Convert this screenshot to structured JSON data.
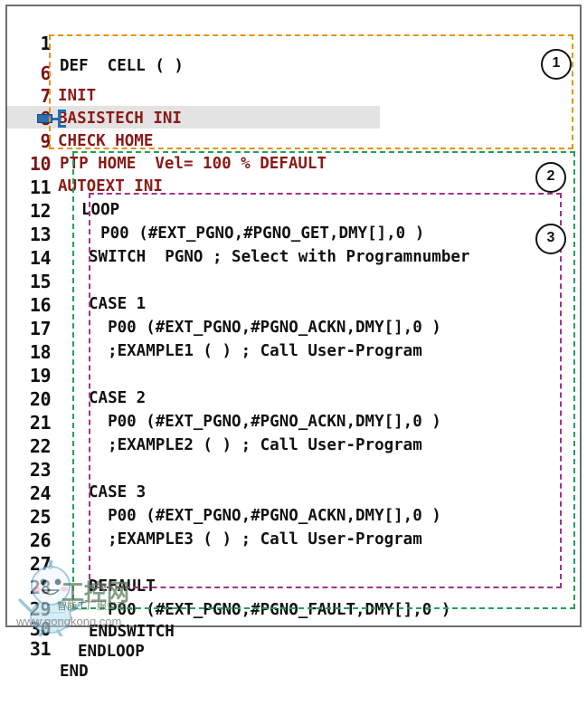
{
  "editor": {
    "name": "krl-program-listing",
    "lines": [
      {
        "num": "1",
        "text": "DEF  CELL ( )",
        "color": "black",
        "indent": 0
      },
      {
        "num": "6",
        "text": "INIT",
        "color": "red",
        "indent": 0
      },
      {
        "num": "7",
        "text": "BASISTECH INI",
        "color": "red",
        "indent": 0
      },
      {
        "num": "8",
        "text": "CHECK HOME",
        "color": "red",
        "indent": 0
      },
      {
        "num": "9",
        "text": "PTP HOME  Vel= 100 % DEFAULT",
        "color": "red",
        "indent": 0
      },
      {
        "num": "10",
        "text": "AUTOEXT INI",
        "color": "red",
        "indent": 0
      },
      {
        "num": "11",
        "text": "LOOP",
        "color": "black",
        "indent": 1
      },
      {
        "num": "12",
        "text": "  P00 (#EXT_PGNO,#PGNO_GET,DMY[],0 )",
        "color": "black",
        "indent": 1
      },
      {
        "num": "13",
        "text": "SWITCH  PGNO ; Select with Programnumber",
        "color": "black",
        "indent": 2
      },
      {
        "num": "14",
        "text": "",
        "color": "black",
        "indent": 2
      },
      {
        "num": "15",
        "text": "CASE 1",
        "color": "black",
        "indent": 2
      },
      {
        "num": "16",
        "text": "  P00 (#EXT_PGNO,#PGNO_ACKN,DMY[],0 )",
        "color": "black",
        "indent": 2
      },
      {
        "num": "17",
        "text": "  ;EXAMPLE1 ( ) ; Call User-Program",
        "color": "black",
        "indent": 2
      },
      {
        "num": "18",
        "text": "",
        "color": "black",
        "indent": 2
      },
      {
        "num": "19",
        "text": "CASE 2",
        "color": "black",
        "indent": 2
      },
      {
        "num": "20",
        "text": "  P00 (#EXT_PGNO,#PGNO_ACKN,DMY[],0 )",
        "color": "black",
        "indent": 2
      },
      {
        "num": "21",
        "text": "  ;EXAMPLE2 ( ) ; Call User-Program",
        "color": "black",
        "indent": 2
      },
      {
        "num": "22",
        "text": "",
        "color": "black",
        "indent": 2
      },
      {
        "num": "23",
        "text": "CASE 3",
        "color": "black",
        "indent": 2
      },
      {
        "num": "24",
        "text": "  P00 (#EXT_PGNO,#PGNO_ACKN,DMY[],0 )",
        "color": "black",
        "indent": 2
      },
      {
        "num": "25",
        "text": "  ;EXAMPLE3 ( ) ; Call User-Program",
        "color": "black",
        "indent": 2
      },
      {
        "num": "26",
        "text": "",
        "color": "black",
        "indent": 2
      },
      {
        "num": "27",
        "text": "DEFAULT",
        "color": "black",
        "indent": 2
      },
      {
        "num": "28",
        "text": "  P00 (#EXT_PGNO,#PGNO_FAULT,DMY[],0 )",
        "color": "black",
        "indent": 2
      },
      {
        "num": "29",
        "text": "ENDSWITCH",
        "color": "black",
        "indent": 2
      },
      {
        "num": "30",
        "text": "ENDLOOP",
        "color": "black",
        "indent": 1
      },
      {
        "num": "31",
        "text": "END",
        "color": "black",
        "indent": 0
      }
    ],
    "current_line": "9"
  },
  "callouts": [
    {
      "label": "1",
      "name": "callout-1"
    },
    {
      "label": "2",
      "name": "callout-2"
    },
    {
      "label": "3",
      "name": "callout-3"
    }
  ],
  "annotations": {
    "box1_color": "#e8911d",
    "box2_color": "#21a05e",
    "box3_color": "#a2318d"
  },
  "markers": {
    "bookmark_color": "#2b6fad",
    "cursor_color": "#1f6fb4",
    "highlight_color": "#e3e3e3"
  },
  "watermark": {
    "url": "www.gongkong.com",
    "tagline": "智能工厂服务商",
    "brand": "工控网",
    "registered": "®"
  }
}
